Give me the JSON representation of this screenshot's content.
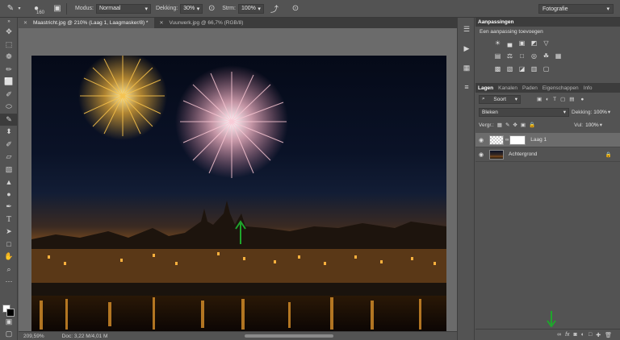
{
  "options": {
    "brush_size": "160",
    "mode_label": "Modus:",
    "mode_value": "Normaal",
    "opacity_label": "Dekking:",
    "opacity_value": "30%",
    "flow_label": "Strm:",
    "flow_value": "100%",
    "workspace": "Fotografie"
  },
  "tabs": [
    {
      "label": "Maastricht.jpg @ 210% (Laag 1, Laagmasker/8) *"
    },
    {
      "label": "Vuurwerk.jpg @ 66,7% (RGB/8)"
    }
  ],
  "status": {
    "zoom": "209,59%",
    "doc": "Doc: 3,22 M/4,01 M"
  },
  "adjustments": {
    "title": "Aanpassingen",
    "subtitle": "Een aanpassing toevoegen"
  },
  "layers_panel": {
    "tabs": [
      "Lagen",
      "Kanalen",
      "Paden",
      "Eigenschappen",
      "Info"
    ],
    "filter": "Soort",
    "blend_mode": "Bleken",
    "opacity_label": "Dekking:",
    "opacity_value": "100%",
    "lock_label": "Vergr.:",
    "fill_label": "Vul:",
    "fill_value": "100%",
    "layers": [
      {
        "name": "Laag 1"
      },
      {
        "name": "Achtergrond"
      }
    ]
  },
  "colors": {
    "accent_arrow": "#1fa52c"
  }
}
